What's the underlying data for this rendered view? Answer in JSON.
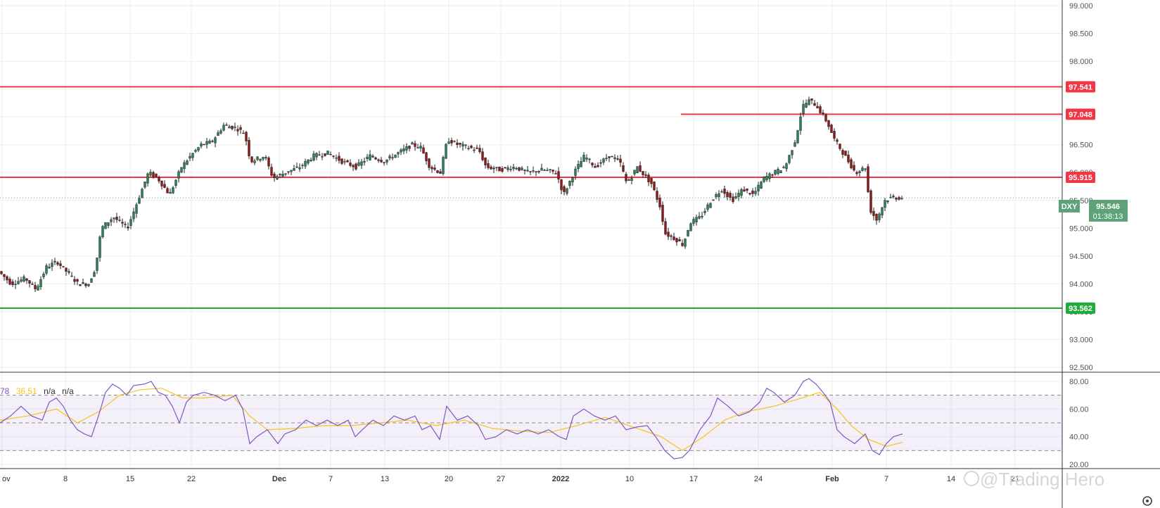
{
  "chart_data": {
    "type": "candlestick",
    "symbol": "DXY",
    "last_price": "95.546",
    "countdown": "01:38:13",
    "price_axis": {
      "min": 92.5,
      "max": 99.0,
      "ticks": [
        "99.000",
        "98.500",
        "98.000",
        "97.500",
        "97.000",
        "96.500",
        "96.000",
        "95.500",
        "95.000",
        "94.500",
        "94.000",
        "93.500",
        "93.000",
        "92.500"
      ]
    },
    "rsi_axis": {
      "min": 20,
      "max": 80,
      "ticks": [
        "80.00",
        "60.00",
        "40.00",
        "20.00"
      ],
      "levels": [
        70,
        50,
        30
      ]
    },
    "x_labels": [
      "ov",
      "8",
      "15",
      "22",
      "Dec",
      "7",
      "13",
      "20",
      "27",
      "2022",
      "10",
      "17",
      "24",
      "Feb",
      "7",
      "14",
      "21"
    ],
    "horizontal_levels": [
      {
        "label": "97.541",
        "value": 97.541,
        "color": "#f23645"
      },
      {
        "label": "97.048",
        "value": 97.048,
        "color": "#f23645"
      },
      {
        "label": "95.915",
        "value": 95.915,
        "color": "#f23645"
      },
      {
        "label": "93.562",
        "value": 93.562,
        "color": "#22ab3d"
      }
    ],
    "rsi_legend": {
      "prefix": "78",
      "ma_value": "36.51",
      "na1": "n/a",
      "na2": "n/a"
    },
    "watermark": "@Trading Hero",
    "price_path": [
      [
        0,
        94.25
      ],
      [
        20,
        94.0
      ],
      [
        40,
        94.1
      ],
      [
        55,
        93.9
      ],
      [
        70,
        94.3
      ],
      [
        85,
        94.4
      ],
      [
        100,
        94.2
      ],
      [
        115,
        94.0
      ],
      [
        130,
        94.0
      ],
      [
        140,
        94.3
      ],
      [
        148,
        95.0
      ],
      [
        165,
        95.2
      ],
      [
        185,
        95.0
      ],
      [
        200,
        95.5
      ],
      [
        215,
        96.0
      ],
      [
        228,
        95.9
      ],
      [
        245,
        95.6
      ],
      [
        262,
        96.1
      ],
      [
        275,
        96.3
      ],
      [
        290,
        96.5
      ],
      [
        305,
        96.55
      ],
      [
        322,
        96.85
      ],
      [
        340,
        96.8
      ],
      [
        352,
        96.7
      ],
      [
        360,
        96.2
      ],
      [
        380,
        96.3
      ],
      [
        392,
        95.9
      ],
      [
        410,
        96.0
      ],
      [
        430,
        96.1
      ],
      [
        450,
        96.3
      ],
      [
        470,
        96.35
      ],
      [
        490,
        96.2
      ],
      [
        510,
        96.1
      ],
      [
        530,
        96.3
      ],
      [
        550,
        96.2
      ],
      [
        570,
        96.35
      ],
      [
        590,
        96.5
      ],
      [
        602,
        96.45
      ],
      [
        615,
        96.1
      ],
      [
        630,
        96.0
      ],
      [
        640,
        96.6
      ],
      [
        655,
        96.5
      ],
      [
        670,
        96.45
      ],
      [
        685,
        96.4
      ],
      [
        695,
        96.1
      ],
      [
        715,
        96.05
      ],
      [
        735,
        96.1
      ],
      [
        755,
        96.0
      ],
      [
        775,
        96.05
      ],
      [
        795,
        96.0
      ],
      [
        805,
        95.6
      ],
      [
        820,
        96.0
      ],
      [
        835,
        96.3
      ],
      [
        850,
        96.1
      ],
      [
        870,
        96.3
      ],
      [
        885,
        96.2
      ],
      [
        895,
        95.8
      ],
      [
        910,
        96.1
      ],
      [
        930,
        95.8
      ],
      [
        942,
        95.4
      ],
      [
        950,
        94.9
      ],
      [
        965,
        94.8
      ],
      [
        975,
        94.7
      ],
      [
        985,
        95.1
      ],
      [
        1000,
        95.2
      ],
      [
        1015,
        95.5
      ],
      [
        1030,
        95.7
      ],
      [
        1045,
        95.5
      ],
      [
        1060,
        95.7
      ],
      [
        1075,
        95.6
      ],
      [
        1090,
        95.9
      ],
      [
        1105,
        96.0
      ],
      [
        1120,
        96.1
      ],
      [
        1135,
        96.6
      ],
      [
        1145,
        97.2
      ],
      [
        1155,
        97.3
      ],
      [
        1165,
        97.2
      ],
      [
        1180,
        96.9
      ],
      [
        1190,
        96.6
      ],
      [
        1200,
        96.4
      ],
      [
        1210,
        96.2
      ],
      [
        1220,
        96.0
      ],
      [
        1235,
        96.1
      ],
      [
        1240,
        95.35
      ],
      [
        1250,
        95.15
      ],
      [
        1262,
        95.5
      ],
      [
        1272,
        95.55
      ],
      [
        1283,
        95.546
      ]
    ],
    "rsi_path": [
      [
        0,
        50
      ],
      [
        15,
        55
      ],
      [
        30,
        62
      ],
      [
        45,
        55
      ],
      [
        60,
        52
      ],
      [
        70,
        65
      ],
      [
        80,
        68
      ],
      [
        90,
        62
      ],
      [
        100,
        52
      ],
      [
        110,
        45
      ],
      [
        120,
        42
      ],
      [
        130,
        40
      ],
      [
        140,
        55
      ],
      [
        150,
        72
      ],
      [
        160,
        78
      ],
      [
        170,
        75
      ],
      [
        180,
        70
      ],
      [
        190,
        77
      ],
      [
        205,
        78
      ],
      [
        215,
        80
      ],
      [
        225,
        72
      ],
      [
        235,
        70
      ],
      [
        245,
        62
      ],
      [
        255,
        50
      ],
      [
        265,
        65
      ],
      [
        275,
        70
      ],
      [
        290,
        72
      ],
      [
        305,
        70
      ],
      [
        320,
        66
      ],
      [
        335,
        70
      ],
      [
        345,
        60
      ],
      [
        355,
        35
      ],
      [
        365,
        40
      ],
      [
        380,
        45
      ],
      [
        395,
        35
      ],
      [
        405,
        42
      ],
      [
        420,
        45
      ],
      [
        435,
        52
      ],
      [
        450,
        48
      ],
      [
        465,
        52
      ],
      [
        480,
        48
      ],
      [
        495,
        52
      ],
      [
        505,
        40
      ],
      [
        515,
        45
      ],
      [
        530,
        52
      ],
      [
        545,
        48
      ],
      [
        560,
        55
      ],
      [
        575,
        52
      ],
      [
        590,
        55
      ],
      [
        600,
        45
      ],
      [
        612,
        48
      ],
      [
        625,
        38
      ],
      [
        635,
        62
      ],
      [
        650,
        52
      ],
      [
        665,
        55
      ],
      [
        680,
        48
      ],
      [
        690,
        38
      ],
      [
        705,
        40
      ],
      [
        720,
        45
      ],
      [
        735,
        42
      ],
      [
        750,
        45
      ],
      [
        765,
        42
      ],
      [
        780,
        45
      ],
      [
        795,
        40
      ],
      [
        805,
        38
      ],
      [
        815,
        55
      ],
      [
        830,
        60
      ],
      [
        845,
        55
      ],
      [
        860,
        52
      ],
      [
        875,
        55
      ],
      [
        890,
        45
      ],
      [
        905,
        47
      ],
      [
        920,
        48
      ],
      [
        932,
        40
      ],
      [
        945,
        30
      ],
      [
        958,
        24
      ],
      [
        970,
        25
      ],
      [
        980,
        30
      ],
      [
        995,
        45
      ],
      [
        1010,
        55
      ],
      [
        1020,
        68
      ],
      [
        1035,
        62
      ],
      [
        1050,
        55
      ],
      [
        1065,
        58
      ],
      [
        1080,
        65
      ],
      [
        1090,
        75
      ],
      [
        1100,
        72
      ],
      [
        1115,
        65
      ],
      [
        1130,
        70
      ],
      [
        1142,
        80
      ],
      [
        1150,
        82
      ],
      [
        1160,
        78
      ],
      [
        1170,
        72
      ],
      [
        1180,
        65
      ],
      [
        1190,
        45
      ],
      [
        1200,
        40
      ],
      [
        1215,
        35
      ],
      [
        1230,
        42
      ],
      [
        1240,
        30
      ],
      [
        1250,
        27
      ],
      [
        1260,
        35
      ],
      [
        1270,
        40
      ],
      [
        1283,
        42
      ]
    ],
    "rsi_ma_path": [
      [
        0,
        52
      ],
      [
        40,
        55
      ],
      [
        80,
        60
      ],
      [
        110,
        50
      ],
      [
        140,
        58
      ],
      [
        170,
        70
      ],
      [
        200,
        74
      ],
      [
        230,
        75
      ],
      [
        260,
        68
      ],
      [
        290,
        68
      ],
      [
        330,
        70
      ],
      [
        355,
        55
      ],
      [
        380,
        45
      ],
      [
        420,
        46
      ],
      [
        460,
        48
      ],
      [
        500,
        48
      ],
      [
        540,
        50
      ],
      [
        580,
        52
      ],
      [
        620,
        48
      ],
      [
        660,
        52
      ],
      [
        700,
        46
      ],
      [
        740,
        44
      ],
      [
        780,
        43
      ],
      [
        820,
        48
      ],
      [
        860,
        54
      ],
      [
        900,
        47
      ],
      [
        940,
        40
      ],
      [
        970,
        30
      ],
      [
        1000,
        40
      ],
      [
        1030,
        52
      ],
      [
        1060,
        58
      ],
      [
        1100,
        62
      ],
      [
        1140,
        68
      ],
      [
        1165,
        72
      ],
      [
        1190,
        60
      ],
      [
        1210,
        48
      ],
      [
        1235,
        38
      ],
      [
        1260,
        33
      ],
      [
        1283,
        36
      ]
    ]
  }
}
